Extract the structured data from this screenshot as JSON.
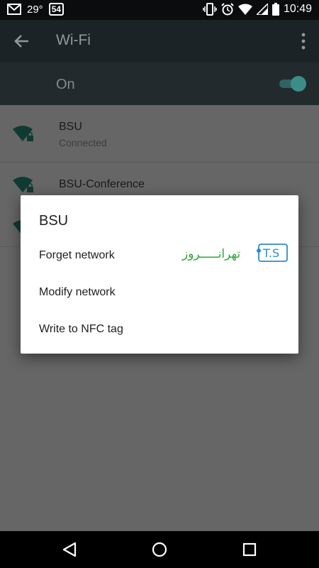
{
  "status_bar": {
    "temperature": "29°",
    "notif_badge": "54",
    "time": "10:49",
    "icons": [
      "gmail-icon",
      "vibrate-icon",
      "alarm-icon",
      "wifi-signal-icon",
      "cellular-signal-icon",
      "battery-icon"
    ]
  },
  "toolbar": {
    "title": "Wi-Fi",
    "icons": [
      "back-arrow-icon",
      "overflow-menu-icon"
    ]
  },
  "master_switch": {
    "label": "On",
    "checked": true,
    "accent_color": "#3c8d87"
  },
  "networks": [
    {
      "name": "BSU",
      "status": "Connected"
    },
    {
      "name": "BSU-Conference",
      "status": ""
    },
    {
      "name": "",
      "status": ""
    }
  ],
  "dialog": {
    "title": "BSU",
    "items": [
      {
        "label": "Forget network"
      },
      {
        "label": "Modify network"
      },
      {
        "label": "Write to NFC tag"
      }
    ],
    "watermark": {
      "letters": "T.S",
      "script_text": "تهرانـــــروز"
    }
  },
  "nav_bar": {
    "icons": [
      "back-triangle-icon",
      "home-circle-icon",
      "recents-square-icon"
    ]
  }
}
